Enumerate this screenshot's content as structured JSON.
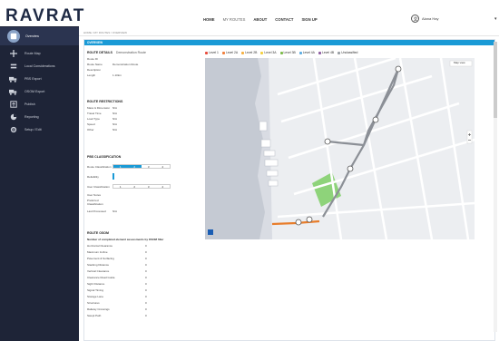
{
  "app": {
    "logo": "RAVRAT"
  },
  "nav": {
    "home": "HOME",
    "my_routes": "MY ROUTES",
    "about": "ABOUT",
    "contact": "CONTACT",
    "signup": "SIGN UP"
  },
  "user": {
    "name": "Alana Hay"
  },
  "sidebar": {
    "items": [
      {
        "label": "Overview",
        "icon": "overview-icon"
      },
      {
        "label": "Route Map",
        "icon": "route-map-icon"
      },
      {
        "label": "Local Considerations",
        "icon": "local-considerations-icon"
      },
      {
        "label": "PBS Export",
        "icon": "truck-icon"
      },
      {
        "label": "OSOM Export",
        "icon": "truck-icon"
      },
      {
        "label": "Publish",
        "icon": "publish-icon"
      },
      {
        "label": "Reporting",
        "icon": "reporting-icon"
      },
      {
        "label": "Setup / Edit",
        "icon": "settings-icon"
      }
    ]
  },
  "breadcrumb": "HOME / MY ROUTES / OVERVIEW",
  "panel": {
    "title": "OVERVIEW"
  },
  "route_details": {
    "heading": "ROUTE DETAILS",
    "heading_value": "Demonstration Route",
    "rows": [
      {
        "label": "Route ID",
        "value": ""
      },
      {
        "label": "Route Name",
        "value": "Demonstration Route"
      },
      {
        "label": "Description",
        "value": ""
      },
      {
        "label": "Length",
        "value": "1.10km"
      }
    ]
  },
  "route_restrictions": {
    "heading": "ROUTE RESTRICTIONS",
    "rows": [
      {
        "label": "Mass & Dimension",
        "value": "N/A"
      },
      {
        "label": "Travel Time",
        "value": "N/A"
      },
      {
        "label": "Load Type",
        "value": "N/A"
      },
      {
        "label": "Speed",
        "value": "N/A"
      },
      {
        "label": "Other",
        "value": "N/A"
      }
    ]
  },
  "pbs_classification": {
    "heading": "PBS CLASSIFICATION",
    "route_classification_label": "Route Classification",
    "route_levels": [
      "1",
      "2",
      "3",
      "4"
    ],
    "selected_level": "2",
    "reliability_label": "Reliability",
    "user_classification_label": "User Classification",
    "user_levels": [
      "1",
      "2",
      "3",
      "4"
    ],
    "user_notes_label": "User Notes",
    "preferred_label": "Preferred Classification",
    "last_processed_label": "Last Processed",
    "last_processed_value": "N/A"
  },
  "route_osom": {
    "heading": "ROUTE OSOM",
    "subheading": "Number of completed element assessments by OSOM filter",
    "rows": [
      {
        "label": "Horizontal Clearance",
        "value": "0"
      },
      {
        "label": "Maximum Incline",
        "value": "0"
      },
      {
        "label": "Pavement & Surfacing",
        "value": "0"
      },
      {
        "label": "Stacking Distance",
        "value": "0"
      },
      {
        "label": "Vertical Clearance",
        "value": "0"
      },
      {
        "label": "Clearance Road Guide",
        "value": "0"
      },
      {
        "label": "Sight Distance",
        "value": "0"
      },
      {
        "label": "Signal Timing",
        "value": "0"
      },
      {
        "label": "Storage Lane",
        "value": "0"
      },
      {
        "label": "Structures",
        "value": "0"
      },
      {
        "label": "Railway Crossings",
        "value": "0"
      },
      {
        "label": "Swept Path",
        "value": "0"
      }
    ]
  },
  "legend": [
    {
      "label": "Level 1",
      "color": "#e84c3d"
    },
    {
      "label": "Level 2A",
      "color": "#f07f3c"
    },
    {
      "label": "Level 2B",
      "color": "#f5b041"
    },
    {
      "label": "Level 3A",
      "color": "#f4d03f"
    },
    {
      "label": "Level 3B",
      "color": "#7dbb4a"
    },
    {
      "label": "Level 4A",
      "color": "#5dade2"
    },
    {
      "label": "Level 4B",
      "color": "#8e5ea2"
    },
    {
      "label": "Unclassified",
      "color": "#9aa0a6"
    }
  ],
  "map": {
    "map_type_label": "Map view"
  },
  "colors": {
    "accent": "#1a9ad6",
    "sidebar": "#1e2437",
    "route": "#e87d2b"
  }
}
